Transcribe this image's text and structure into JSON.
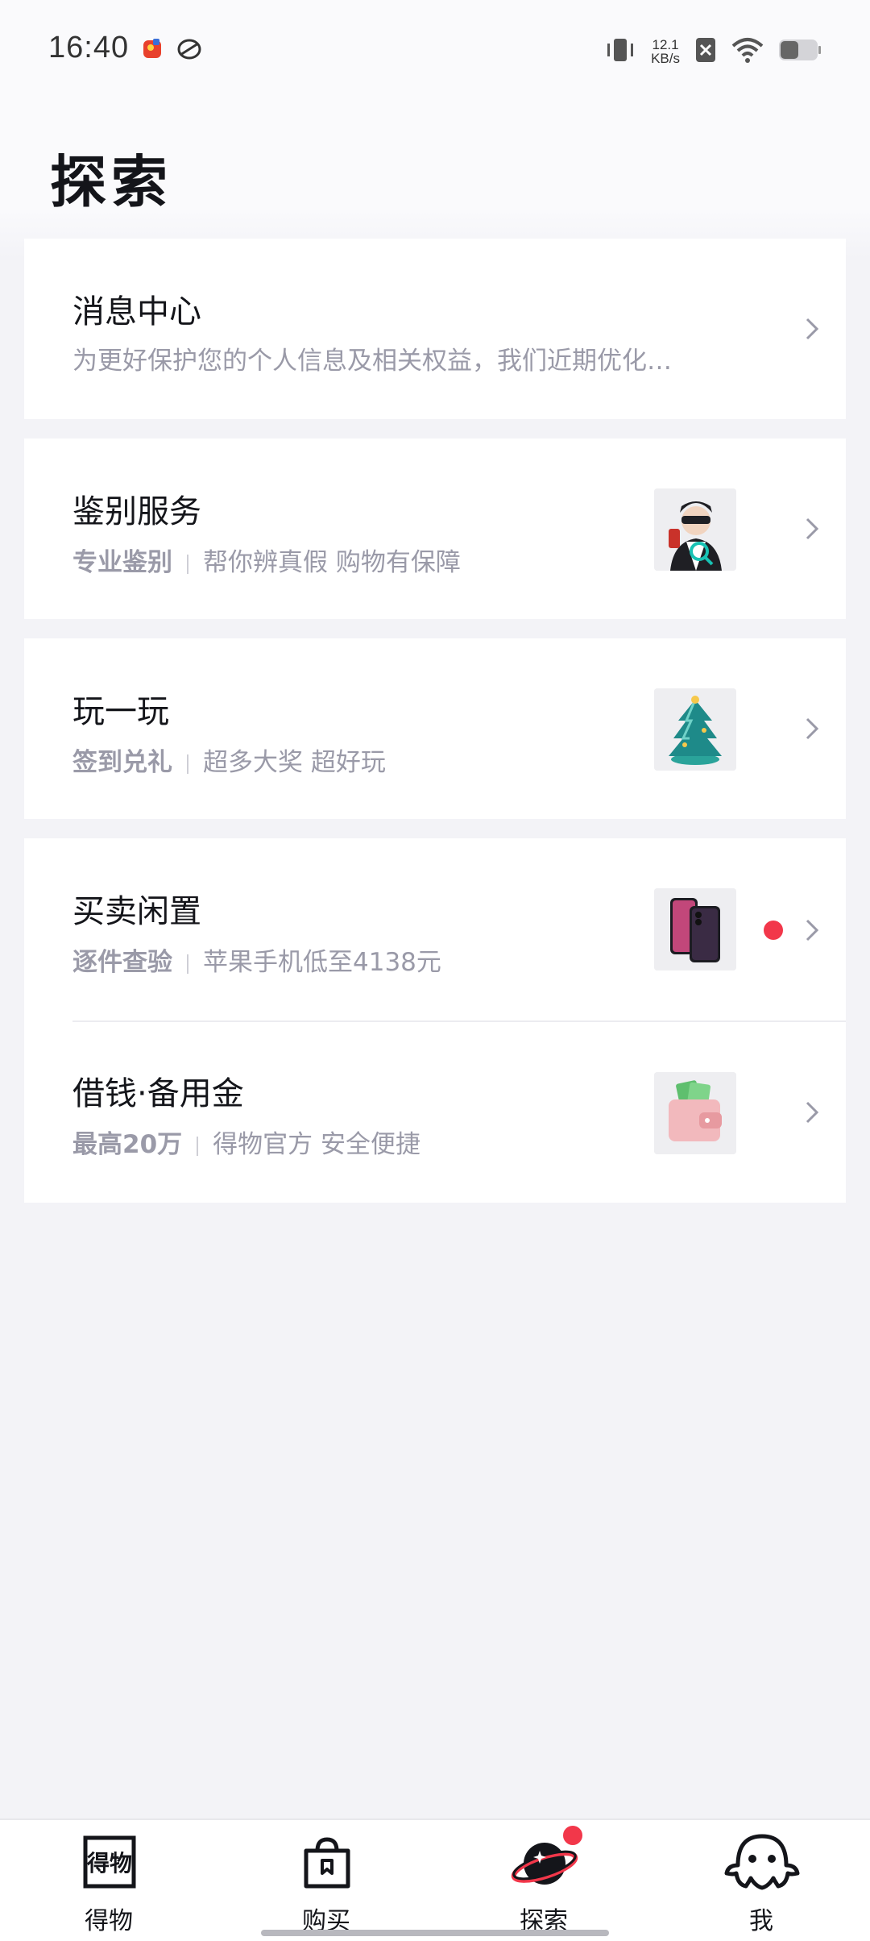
{
  "status_bar": {
    "time": "16:40",
    "net_speed_value": "12.1",
    "net_speed_unit": "KB/s"
  },
  "page": {
    "title": "探索"
  },
  "cards": [
    {
      "title": "消息中心",
      "subtitle": "为更好保护您的个人信息及相关权益，我们近期优化…"
    },
    {
      "title": "鉴别服务",
      "tag": "专业鉴别",
      "subtitle": "帮你辨真假 购物有保障",
      "thumb": "authenticator-figure-image"
    },
    {
      "title": "玩一玩",
      "tag": "签到兑礼",
      "subtitle": "超多大奖 超好玩",
      "thumb": "christmas-tree-image"
    },
    {
      "title": "买卖闲置",
      "tag": "逐件查验",
      "subtitle": "苹果手机低至4138元",
      "thumb": "iphone-image",
      "has_red_dot": true
    },
    {
      "title": "借钱·备用金",
      "tag": "最高20万",
      "subtitle": "得物官方 安全便捷",
      "thumb": "wallet-image"
    }
  ],
  "tab_bar": {
    "tabs": [
      {
        "label": "得物",
        "icon": "dewu-logo-icon"
      },
      {
        "label": "购买",
        "icon": "shopping-bag-icon"
      },
      {
        "label": "探索",
        "icon": "planet-icon",
        "active": true,
        "badge": true
      },
      {
        "label": "我",
        "icon": "octopus-icon"
      }
    ]
  },
  "colors": {
    "background": "#f3f3f7",
    "card": "#ffffff",
    "badge_red": "#f2374a",
    "subtle_text": "#9a9aa8"
  }
}
